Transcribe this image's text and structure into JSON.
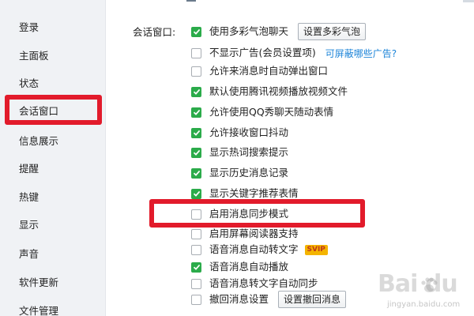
{
  "sidebar": {
    "items": [
      {
        "label": "登录"
      },
      {
        "label": "主面板"
      },
      {
        "label": "状态"
      },
      {
        "label": "会话窗口"
      },
      {
        "label": "信息展示"
      },
      {
        "label": "提醒"
      },
      {
        "label": "热键"
      },
      {
        "label": "显示"
      },
      {
        "label": "声音"
      },
      {
        "label": "软件更新"
      },
      {
        "label": "文件管理"
      }
    ],
    "selected": "会话窗口"
  },
  "main": {
    "section_label": "会话窗口:",
    "options": [
      {
        "label": "使用多彩气泡聊天",
        "checked": true,
        "button": "设置多彩气泡"
      },
      {
        "label": "不显示广告(会员设置项)",
        "checked": false,
        "link": "可屏蔽哪些广告?"
      },
      {
        "label": "允许来消息时自动弹出窗口",
        "checked": false
      },
      {
        "label": "默认使用腾讯视频播放视频文件",
        "checked": true
      },
      {
        "label": "允许使用QQ秀聊天随动表情",
        "checked": true
      },
      {
        "label": "允许接收窗口抖动",
        "checked": true
      },
      {
        "label": "显示热词搜索提示",
        "checked": true
      },
      {
        "label": "显示历史消息记录",
        "checked": true
      },
      {
        "label": "显示关键字推荐表情",
        "checked": true
      },
      {
        "label": "启用消息同步模式",
        "checked": false
      },
      {
        "label": "启用屏幕阅读器支持",
        "checked": false
      },
      {
        "label": "语音消息自动转文字",
        "checked": false,
        "badge": "SVIP"
      },
      {
        "label": "语音消息自动播放",
        "checked": true
      },
      {
        "label": "语音消息转文字自动同步",
        "checked": false
      },
      {
        "label": "撤回消息设置",
        "checked": false,
        "button": "设置撤回消息"
      }
    ]
  },
  "watermark": {
    "main": "Bai du",
    "sub": "jingyan.baidu.com"
  },
  "colors": {
    "check_green": "#2bab4a",
    "highlight_red": "#e21b2b",
    "link_blue": "#1d84d8",
    "sidebar_bg": "#f0f2f5"
  }
}
